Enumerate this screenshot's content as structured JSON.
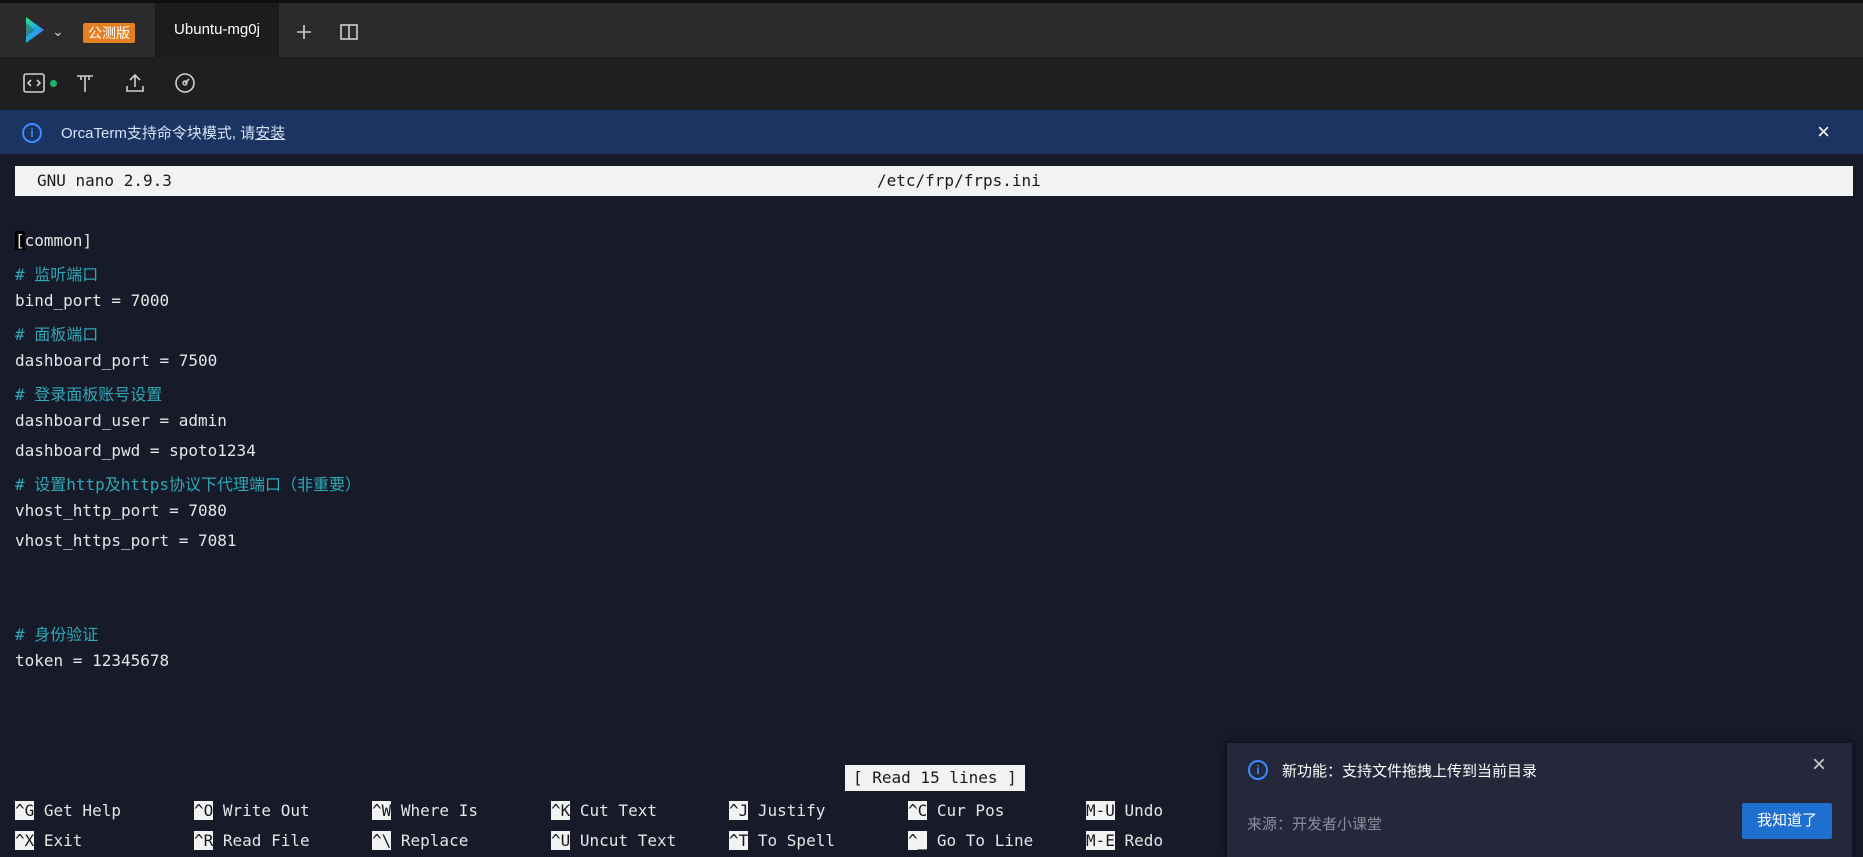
{
  "titlebar": {
    "beta_badge": "公测版",
    "tab_label": "Ubuntu-mg0j"
  },
  "banner": {
    "text": "OrcaTerm支持命令块模式, 请",
    "link": "安装"
  },
  "editor": {
    "version": "GNU nano 2.9.3",
    "filename": "/etc/frp/frps.ini",
    "cursor_char": "[",
    "lines": {
      "l1_rest": "common]",
      "l2": "# 监听端口",
      "l3": "bind_port = 7000",
      "l4": "# 面板端口",
      "l5": "dashboard_port = 7500",
      "l6": "# 登录面板账号设置",
      "l7": "dashboard_user = admin",
      "l8": "dashboard_pwd = spoto1234",
      "l9": "# 设置http及https协议下代理端口（非重要）",
      "l10": "vhost_http_port = 7080",
      "l11": "vhost_https_port = 7081",
      "l12": "# 身份验证",
      "l13": "token = 12345678"
    },
    "status_message": "[ Read 15 lines ]",
    "shortcuts": {
      "r1": [
        {
          "key": "^G",
          "label": " Get Help"
        },
        {
          "key": "^O",
          "label": " Write Out"
        },
        {
          "key": "^W",
          "label": " Where Is"
        },
        {
          "key": "^K",
          "label": " Cut Text"
        },
        {
          "key": "^J",
          "label": " Justify"
        },
        {
          "key": "^C",
          "label": " Cur Pos"
        },
        {
          "key": "M-U",
          "label": " Undo"
        }
      ],
      "r2": [
        {
          "key": "^X",
          "label": " Exit"
        },
        {
          "key": "^R",
          "label": " Read File"
        },
        {
          "key": "^\\",
          "label": " Replace"
        },
        {
          "key": "^U",
          "label": " Uncut Text"
        },
        {
          "key": "^T",
          "label": " To Spell"
        },
        {
          "key": "^_",
          "label": " Go To Line"
        },
        {
          "key": "M-E",
          "label": " Redo"
        }
      ]
    }
  },
  "notice": {
    "title": "新功能：支持文件拖拽上传到当前目录",
    "source": "来源：开发者小课堂",
    "button": "我知道了"
  }
}
